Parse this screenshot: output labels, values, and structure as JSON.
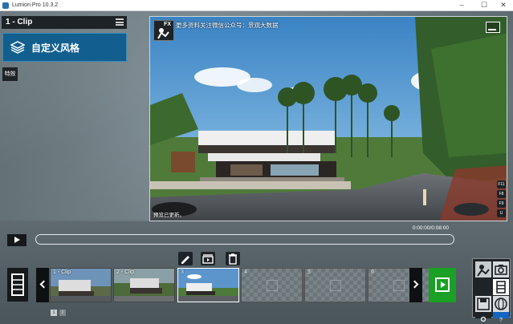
{
  "window": {
    "title": "Lumion Pro 10.3.2",
    "controls": {
      "minimize": "–",
      "maximize": "☐",
      "close": "✕"
    }
  },
  "left_panel": {
    "clip_title": "1 - Clip",
    "style_button": "自定义风格",
    "effects_tab": "特效"
  },
  "viewport": {
    "fx_badge": "FX",
    "watermark": "更多资料关注微信公众号：景观大数据",
    "status": "预览已更新。",
    "function_keys": [
      "F11",
      "F8",
      "F9",
      "U"
    ]
  },
  "transport": {
    "time": "0:00:00/0:08:00"
  },
  "timeline": {
    "clips": [
      {
        "num": "1 - Clip",
        "selected": false
      },
      {
        "num": "2 - Clip",
        "selected": false
      },
      {
        "num": "3",
        "selected": true
      }
    ],
    "empty_slots": [
      "4",
      "5",
      "6"
    ],
    "pages": [
      "1",
      "2"
    ]
  },
  "colors": {
    "accent_blue": "#125f8f",
    "add_green": "#1aa025",
    "panel_dark": "#1e2328"
  }
}
